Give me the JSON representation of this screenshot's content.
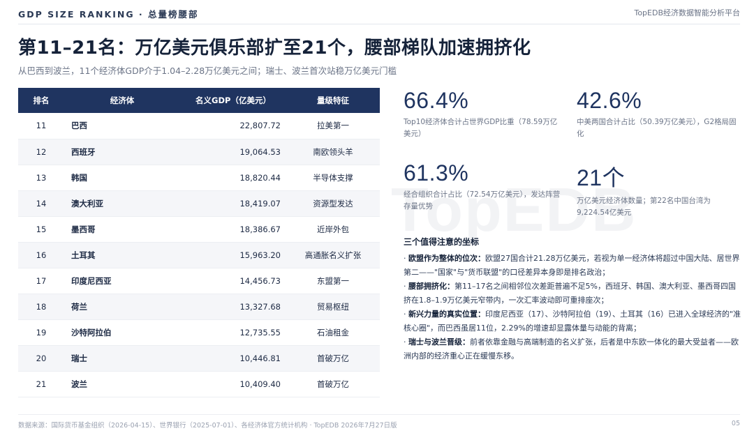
{
  "header": {
    "section_label": "GDP SIZE RANKING · 总量榜腰部",
    "brand": "TopEDB经济数据智能分析平台"
  },
  "title": "第11–21名：万亿美元俱乐部扩至21个，腰部梯队加速拥挤化",
  "subtitle": "从巴西到波兰，11个经济体GDP介于1.04–2.28万亿美元之间；瑞士、波兰首次站稳万亿美元门槛",
  "watermark": "TopEDB",
  "table": {
    "headers": [
      "排名",
      "经济体",
      "名义GDP（亿美元）",
      "量级特征"
    ],
    "rows": [
      {
        "rank": "11",
        "name": "巴西",
        "gdp": "22,807.72",
        "feature": "拉美第一"
      },
      {
        "rank": "12",
        "name": "西班牙",
        "gdp": "19,064.53",
        "feature": "南欧领头羊"
      },
      {
        "rank": "13",
        "name": "韩国",
        "gdp": "18,820.44",
        "feature": "半导体支撑"
      },
      {
        "rank": "14",
        "name": "澳大利亚",
        "gdp": "18,419.07",
        "feature": "资源型发达"
      },
      {
        "rank": "15",
        "name": "墨西哥",
        "gdp": "18,386.67",
        "feature": "近岸外包"
      },
      {
        "rank": "16",
        "name": "土耳其",
        "gdp": "15,963.20",
        "feature": "高通胀名义扩张"
      },
      {
        "rank": "17",
        "name": "印度尼西亚",
        "gdp": "14,456.73",
        "feature": "东盟第一"
      },
      {
        "rank": "18",
        "name": "荷兰",
        "gdp": "13,327.68",
        "feature": "贸易枢纽"
      },
      {
        "rank": "19",
        "name": "沙特阿拉伯",
        "gdp": "12,735.55",
        "feature": "石油租金"
      },
      {
        "rank": "20",
        "name": "瑞士",
        "gdp": "10,446.81",
        "feature": "首破万亿"
      },
      {
        "rank": "21",
        "name": "波兰",
        "gdp": "10,409.40",
        "feature": "首破万亿"
      }
    ]
  },
  "stats": [
    {
      "value": "66.4%",
      "desc": "Top10经济体合计占世界GDP比重（78.59万亿美元）"
    },
    {
      "value": "42.6%",
      "desc": "中美两国合计占比（50.39万亿美元），G2格局固化"
    },
    {
      "value": "61.3%",
      "desc": "经合组织合计占比（72.54万亿美元），发达阵营存量优势"
    },
    {
      "value": "21个",
      "desc": "万亿美元经济体数量；第22名中国台湾为9,224.54亿美元"
    }
  ],
  "notes": {
    "title": "三个值得注意的坐标",
    "items": [
      {
        "lead": "欧盟作为整体的位次：",
        "text": "欧盟27国合计21.28万亿美元，若视为单一经济体将超过中国大陆、居世界第二——\"国家\"与\"货币联盟\"的口径差异本身即是排名政治；"
      },
      {
        "lead": "腰部拥挤化：",
        "text": "第11–17名之间相邻位次差距普遍不足5%，西班牙、韩国、澳大利亚、墨西哥四国挤在1.8–1.9万亿美元窄带内，一次汇率波动即可重排座次；"
      },
      {
        "lead": "新兴力量的真实位置：",
        "text": "印度尼西亚（17）、沙特阿拉伯（19）、土耳其（16）已进入全球经济的\"准核心圈\"，而巴西虽居11位，2.29%的增速却显露体量与动能的背离；"
      },
      {
        "lead": "瑞士与波兰晋级：",
        "text": "前者依靠金融与高端制造的名义扩张，后者是中东欧一体化的最大受益者——欧洲内部的经济重心正在缓慢东移。"
      }
    ]
  },
  "footer": {
    "source": "数据来源：国际货币基金组织（2026-04-15）、世界银行（2025-07-01）、各经济体官方统计机构 · TopEDB 2026年7月27日版",
    "page": "05"
  }
}
